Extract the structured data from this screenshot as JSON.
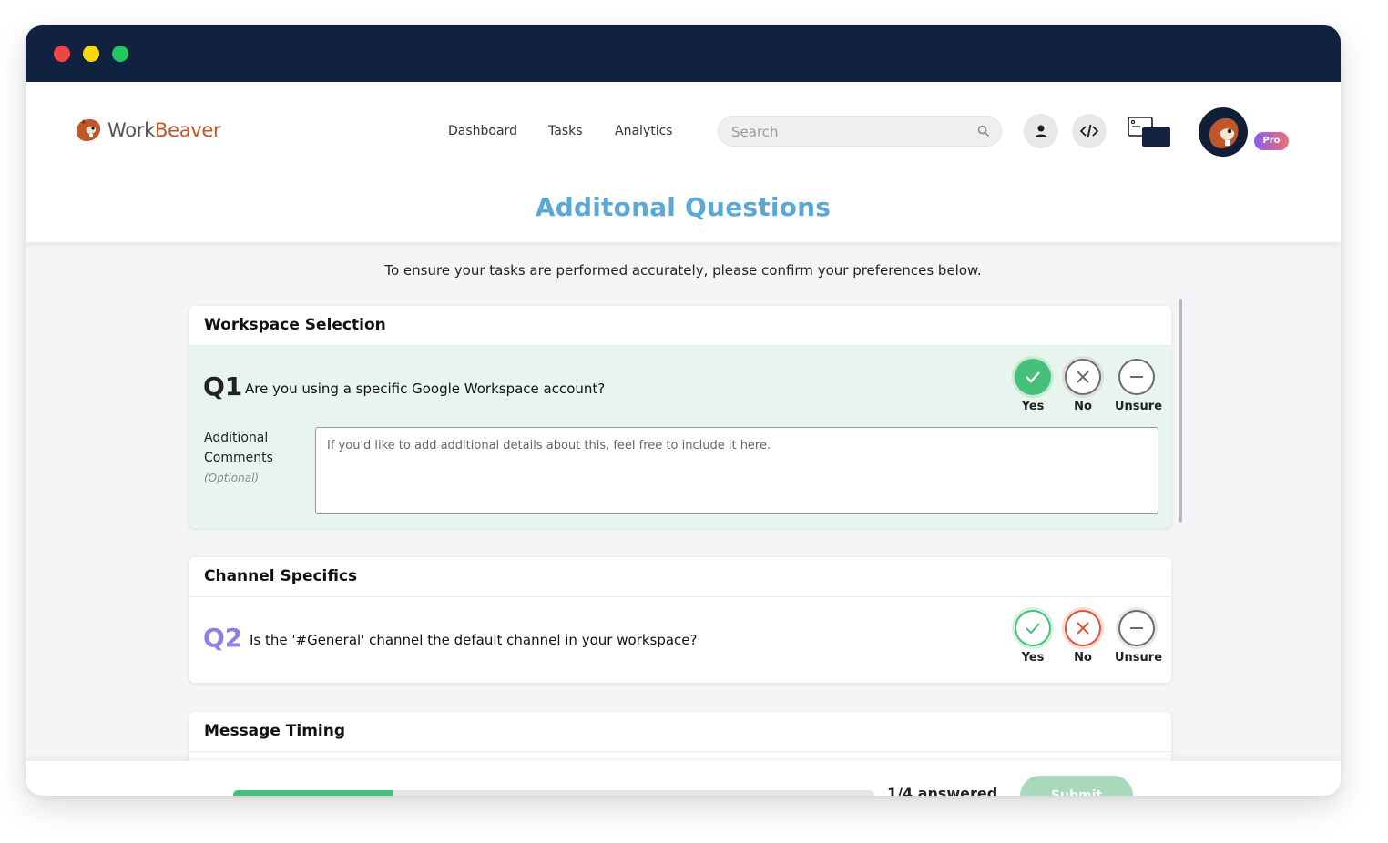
{
  "window": {
    "controls": [
      "close",
      "minimize",
      "maximize"
    ]
  },
  "brand": {
    "name_part1": "Work",
    "name_part2": "Beaver",
    "accent_color": "#c0572b"
  },
  "nav": {
    "items": [
      {
        "label": "Dashboard"
      },
      {
        "label": "Tasks"
      },
      {
        "label": "Analytics"
      }
    ]
  },
  "search": {
    "placeholder": "Search",
    "value": ""
  },
  "header_icons": [
    "user-icon",
    "code-icon",
    "screens-icon"
  ],
  "account": {
    "badge": "Pro"
  },
  "page": {
    "title": "Additonal Questions",
    "title_color": "#5aa8d8",
    "intro": "To ensure your tasks are performed accurately, please confirm your preferences below."
  },
  "sections": [
    {
      "title": "Workspace Selection",
      "question": {
        "number": "Q1",
        "text": "Are you using a specific Google Workspace account?",
        "selected": "Yes",
        "options": [
          "Yes",
          "No",
          "Unsure"
        ]
      },
      "comments": {
        "label_line1": "Additional",
        "label_line2": "Comments",
        "optional_note": "(Optional)",
        "placeholder": "If you'd like to add additional details about this, feel free to include it here.",
        "value": ""
      }
    },
    {
      "title": "Channel Specifics",
      "question": {
        "number": "Q2",
        "text": "Is the '#General' channel the default channel in your workspace?",
        "selected": null,
        "options": [
          "Yes",
          "No",
          "Unsure"
        ]
      }
    },
    {
      "title": "Message Timing"
    }
  ],
  "footer": {
    "progress": 0.25,
    "answered_text": "1/4 answered",
    "submit_label": "Submit"
  },
  "colors": {
    "yes": "#45c07a",
    "no": "#d9533b",
    "unsure": "#6b6b6b",
    "q1": "#222222",
    "q2": "#8b80e6",
    "selected_bg": "#e8f4ee"
  }
}
